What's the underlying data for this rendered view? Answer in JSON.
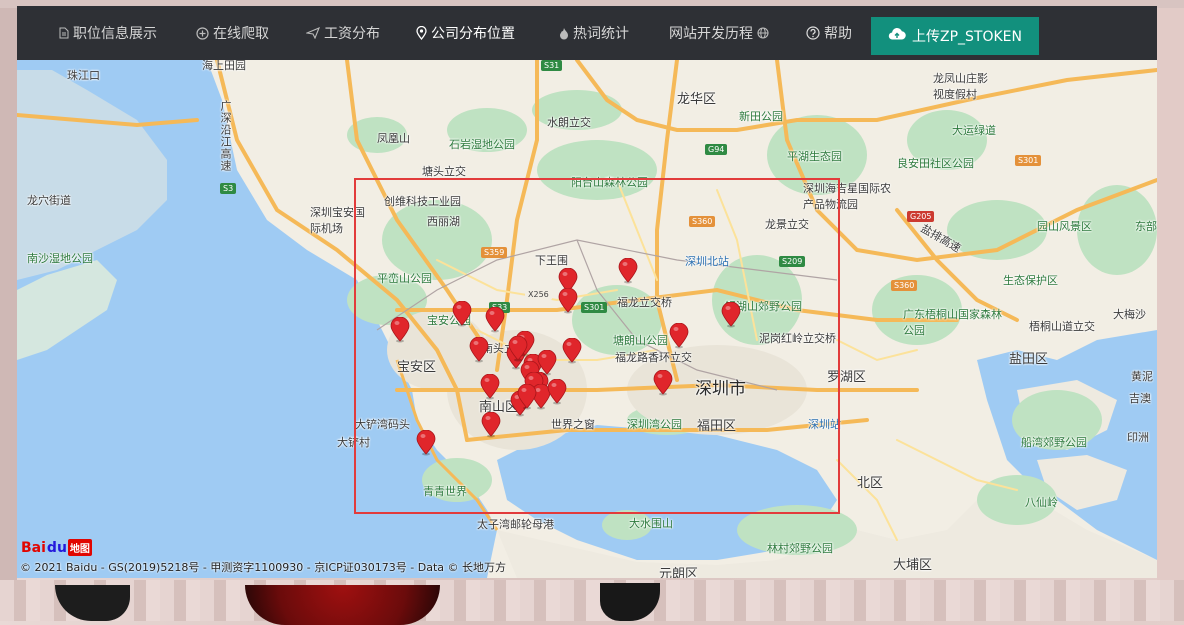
{
  "navbar": {
    "items": [
      {
        "label": "职位信息展示",
        "icon": "document-icon"
      },
      {
        "label": "在线爬取",
        "icon": "plus-circle-icon"
      },
      {
        "label": "工资分布",
        "icon": "paper-plane-icon"
      },
      {
        "label": "公司分布位置",
        "icon": "map-pin-icon"
      },
      {
        "label": "热词统计",
        "icon": "fire-icon"
      },
      {
        "label": "网站开发历程",
        "icon": "globe-icon"
      },
      {
        "label": "帮助",
        "icon": "question-circle-icon"
      }
    ],
    "active": "公司分布位置",
    "upload_button": {
      "label": "上传ZP_STOKEN",
      "icon": "cloud-upload-icon",
      "color": "#12907d"
    }
  },
  "map": {
    "city_label": "深圳市",
    "labels": {
      "l1": "珠江口",
      "l2": "海上田园",
      "l3": "广深沿江高速",
      "l4": "凤凰山",
      "l5": "石岩湿地公园",
      "l6": "水朗立交",
      "l7": "龙华区",
      "l8": "新田公园",
      "l9": "龙凤山庄影视度假村",
      "l10": "大运绿道",
      "l11": "平湖生态园",
      "l12": "良安田社区公园",
      "l13": "塘头立交",
      "l14": "阳台山森林公园",
      "l15": "创维科技工业园",
      "l16": "深圳宝安国际机场",
      "l17": "龙穴街道",
      "l18": "深圳海吉星国际农产品物流园",
      "l19": "龙景立交",
      "l20": "深圳北站",
      "l21": "南沙湿地公园",
      "l22": "平峦山公园",
      "l23": "福龙立交桥",
      "l24": "银湖山郊野公园",
      "l25": "泥岗红岭立交桥",
      "l26": "宝安公园",
      "l27": "南头立交",
      "l28": "塘朗山公园",
      "l29": "福龙路香环立交",
      "l30": "宝安区",
      "l31": "南山区",
      "l32": "罗湖区",
      "l33": "大铲湾码头",
      "l34": "世界之窗",
      "l35": "深圳湾公园",
      "l36": "福田区",
      "l37": "深圳站",
      "l38": "青青世界",
      "l39": "北区",
      "l40": "太子湾邮轮母港",
      "l41": "大水围山",
      "l42": "林村郊野公园",
      "l43": "元朗区",
      "l44": "大埔区",
      "l45": "八仙岭",
      "l46": "船湾郊野公园",
      "l47": "印洲",
      "l48": "盐田区",
      "l49": "梧桐山道立交",
      "l50": "广东梧桐山国家森林公园",
      "l51": "生态保护区",
      "l52": "大梅沙",
      "l53": "园山风景区",
      "l54": "东部",
      "l55": "盐排高速",
      "l56": "黄泥",
      "l57": "吉澳",
      "l58": "大铲村",
      "l59": "下王围",
      "l60": "西丽湖"
    },
    "road_tags": [
      "S31",
      "G94",
      "S301",
      "S360",
      "S359",
      "S33",
      "S301",
      "S209",
      "G205",
      "S3",
      "X256",
      "S360"
    ],
    "marker_count": 26,
    "copyright": "© 2021 Baidu - GS(2019)5218号 - 甲测资字1100930 - 京ICP证030173号 - Data © 长地万方",
    "logo": "Bai地图"
  },
  "colors": {
    "navbar_bg": "#2e3035",
    "accent": "#12907d",
    "selection_border": "#e23b3b",
    "marker": "#e0262b"
  }
}
